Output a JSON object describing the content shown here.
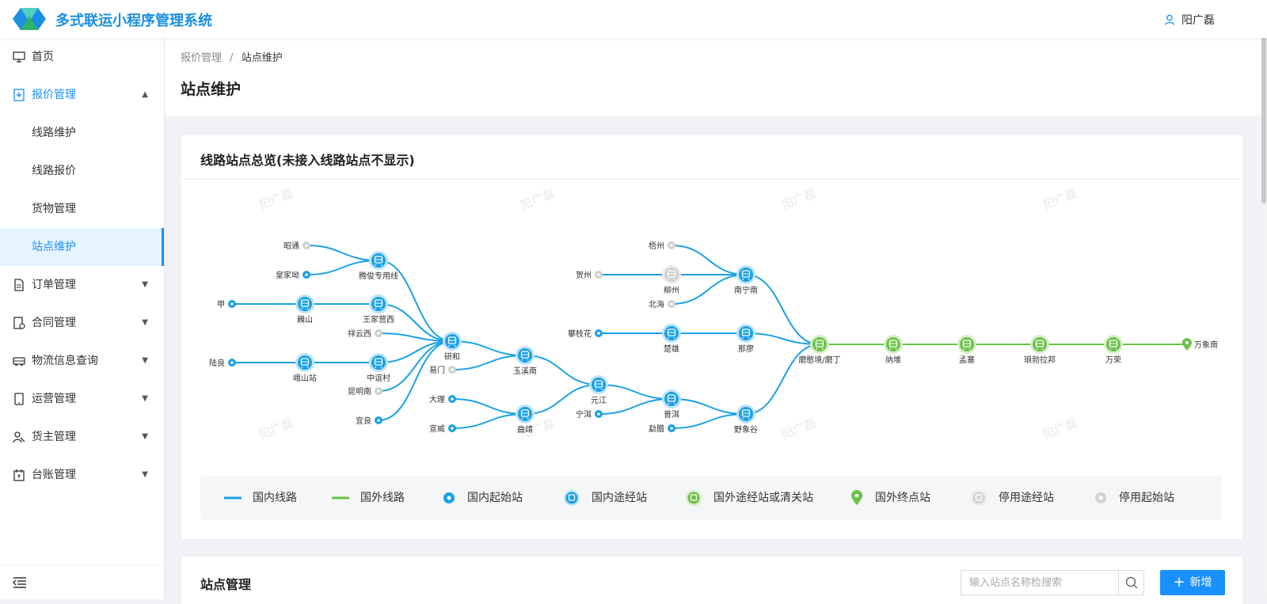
{
  "app": {
    "title": "多式联运小程序管理系统",
    "user": "阳广磊"
  },
  "sidebar": {
    "items": [
      {
        "label": "首页",
        "icon": "monitor-icon"
      },
      {
        "label": "报价管理",
        "icon": "quote-icon",
        "expanded": true
      },
      {
        "label": "线路维护"
      },
      {
        "label": "线路报价"
      },
      {
        "label": "货物管理"
      },
      {
        "label": "站点维护",
        "selected": true
      },
      {
        "label": "订单管理",
        "icon": "order-icon"
      },
      {
        "label": "合同管理",
        "icon": "contract-icon"
      },
      {
        "label": "物流信息查询",
        "icon": "truck-icon"
      },
      {
        "label": "运营管理",
        "icon": "tablet-icon"
      },
      {
        "label": "货主管理",
        "icon": "user-group-icon"
      },
      {
        "label": "台账管理",
        "icon": "calendar-icon"
      }
    ]
  },
  "breadcrumb": {
    "parent": "报价管理",
    "sep": "/",
    "current": "站点维护"
  },
  "page_title": "站点维护",
  "overview": {
    "title": "线路站点总览(未接入线路站点不显示)",
    "watermark": "阳广磊",
    "stations": [
      "昭通",
      "皇家坳",
      "腾俊专用线",
      "甲",
      "巍山",
      "王家营西",
      "祥云西",
      "陆良",
      "峨山站",
      "中谊村",
      "昆明南",
      "宜良",
      "研和",
      "易门",
      "玉溪南",
      "大理",
      "宣威",
      "曲靖",
      "元江",
      "宁洱",
      "梧州",
      "贺州",
      "柳州",
      "北海",
      "南宁南",
      "攀枝花",
      "楚雄",
      "那廖",
      "普洱",
      "勐腊",
      "野象谷",
      "磨憨境/磨丁",
      "纳堆",
      "孟塞",
      "琅勃拉邦",
      "万荣",
      "万象南"
    ],
    "colors": {
      "domestic": "#1aa1e6",
      "foreign": "#6cc24a",
      "stopped": "#cfcfcf"
    }
  },
  "legend": [
    {
      "label": "国内线路",
      "icon": "domestic-line-icon"
    },
    {
      "label": "国外线路",
      "icon": "foreign-line-icon"
    },
    {
      "label": "国内起始站",
      "icon": "domestic-start-icon"
    },
    {
      "label": "国内途经站",
      "icon": "domestic-via-icon"
    },
    {
      "label": "国外途经站或清关站",
      "icon": "foreign-via-icon"
    },
    {
      "label": "国外终点站",
      "icon": "foreign-end-icon"
    },
    {
      "label": "停用途经站",
      "icon": "stopped-via-icon"
    },
    {
      "label": "停用起始站",
      "icon": "stopped-start-icon"
    }
  ],
  "station_mgmt": {
    "title": "站点管理",
    "search_placeholder": "输入站点名称检搜索",
    "add_label": "新增"
  }
}
